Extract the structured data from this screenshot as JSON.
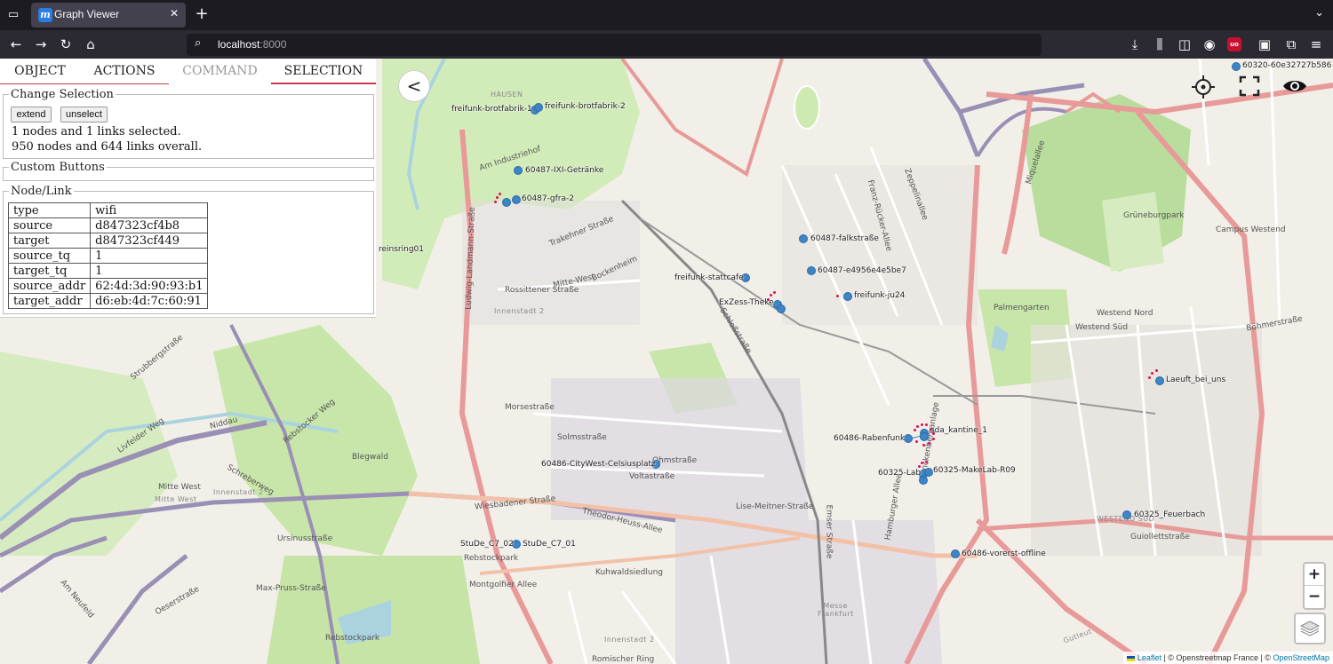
{
  "browser": {
    "tab_title": "Graph Viewer",
    "url_host": "localhost",
    "url_port": ":8000"
  },
  "panel": {
    "tabs": [
      {
        "label": "OBJECT"
      },
      {
        "label": "ACTIONS"
      },
      {
        "label": "COMMAND"
      },
      {
        "label": "SELECTION"
      }
    ],
    "change_selection": {
      "legend": "Change Selection",
      "extend_label": "extend",
      "unselect_label": "unselect",
      "selected_text": "1 nodes and 1 links selected.",
      "overall_text": "950 nodes and 644 links overall."
    },
    "custom_buttons_legend": "Custom Buttons",
    "node_link": {
      "legend": "Node/Link",
      "rows": [
        {
          "key": "type",
          "value": "wifi"
        },
        {
          "key": "source",
          "value": "d847323cf4b8"
        },
        {
          "key": "target",
          "value": "d847323cf449"
        },
        {
          "key": "source_tq",
          "value": "1"
        },
        {
          "key": "target_tq",
          "value": "1"
        },
        {
          "key": "source_addr",
          "value": "62:4d:3d:90:93:b1"
        },
        {
          "key": "target_addr",
          "value": "d6:eb:4d:7c:60:91"
        }
      ]
    },
    "collapse_label": "<"
  },
  "map": {
    "node_labels": {
      "n1": "freifunk-brotfabrik-1",
      "n2": "freifunk-brotfabrik-2",
      "n3": "60487-IXI-Getränke",
      "n4": "60487-gfra-2",
      "n5": "reinsring01",
      "n6": "60487-falkstraße",
      "n7": "60487-e4956e4e5be7",
      "n8": "freifunk-stattcafe",
      "n9": "freifunk-ju24",
      "n10": "ExZess-Theke",
      "n11": "Laeuft_bei_uns",
      "n12": "60486-Rabenfunk",
      "n13": "ada_kantine_1",
      "n14": "60325-Lab",
      "n15": "60325-MakeLab-R09",
      "n16": "60486-CityWest-Celsiusplatz",
      "n17": "60325_Feuerbach",
      "n18": "StuDe_C7_02",
      "n19": "StuDe_C7_01",
      "n20": "60486-vorerst-offline",
      "n21": "60320-60e32727b586"
    },
    "streets": {
      "s1": "HAUSEN",
      "s2": "Am Industriehof",
      "s3": "Rossittener Straße",
      "s4": "Mitte-West",
      "s5": "Bockenheim",
      "s6": "Innenstadt 2",
      "s7": "Morsestraße",
      "s8": "Solmsstraße",
      "s9": "Ohmstraße",
      "s10": "Voltastraße",
      "s11": "Wiesbadener Straße",
      "s12": "Theodor-Heuss-Allee",
      "s13": "Lise-Meitner-Straße",
      "s14": "Rebstockpark",
      "s15": "Montgolfier Allee",
      "s16": "Kuhwaldsiedlung",
      "s17": "Max-Pruss-Straße",
      "s18": "Ursinusstraße",
      "s19": "Rebstocker Weg",
      "s20": "Blegwald",
      "s21": "Schreberweg",
      "s22": "Strubbergstraße",
      "s23": "Livfelder Weg",
      "s24": "Am Neufeld",
      "s25": "Oeserstraße",
      "s26": "Grüneburgpark",
      "s27": "Campus Westend",
      "s28": "Palmengarten",
      "s29": "Westend Süd",
      "s30": "Westend Nord",
      "s31": "Böhmerstraße",
      "s32": "Guiollettstraße",
      "s33": "WESTEND SÜD",
      "s34": "Messe Frankfurt",
      "s35": "Romischer Ring",
      "s36": "Miquelallee",
      "s37": "Zeppelinallee",
      "s38": "Franz-Rücker-Allee",
      "s39": "Schloßstraße",
      "s40": "Mitte West",
      "s41": "Rebstockpark",
      "s42": "Emser Straße",
      "s43": "Hamburger Allee",
      "s44": "Senckenberganlage",
      "s45": "Niddau",
      "s46": "Ludwig-Landmann-Straße",
      "s47": "Trakehner Straße",
      "s48": "Innenstadt 2",
      "s49": "Mitte West",
      "s50": "Gutleut",
      "s51": "Innenstadt 2"
    },
    "zoom_in": "+",
    "zoom_out": "−",
    "attribution": {
      "leaflet": "Leaflet",
      "sep1": " | © Openstreetmap France | © ",
      "osm": "OpenStreetMap"
    }
  }
}
